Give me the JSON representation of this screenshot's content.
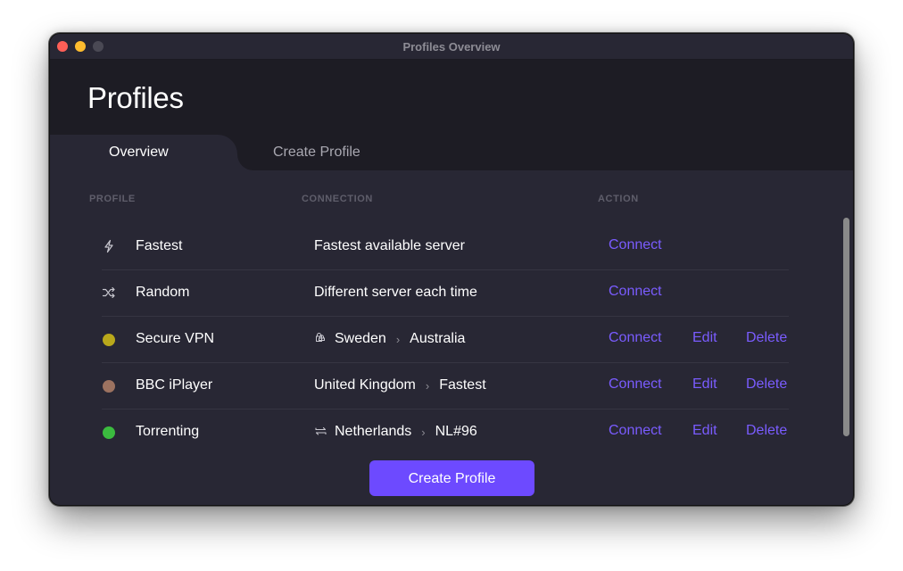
{
  "window": {
    "title": "Profiles Overview",
    "controls": [
      "close",
      "minimize",
      "maximize"
    ]
  },
  "header": {
    "title": "Profiles"
  },
  "tabs": [
    {
      "label": "Overview",
      "active": true
    },
    {
      "label": "Create Profile",
      "active": false
    }
  ],
  "table": {
    "columns": [
      "PROFILE",
      "CONNECTION",
      "ACTION"
    ],
    "rows": [
      {
        "icon": "lightning-icon",
        "name": "Fastest",
        "connection": {
          "text": "Fastest available server"
        },
        "actions": [
          "Connect"
        ]
      },
      {
        "icon": "shuffle-icon",
        "name": "Random",
        "connection": {
          "text": "Different server each time"
        },
        "actions": [
          "Connect"
        ]
      },
      {
        "dot_color": "#b9a81b",
        "name": "Secure VPN",
        "connection": {
          "icon": "secure-core-lock-icon",
          "from": "Sweden",
          "to": "Australia"
        },
        "actions": [
          "Connect",
          "Edit",
          "Delete"
        ]
      },
      {
        "dot_color": "#9c7260",
        "name": "BBC iPlayer",
        "connection": {
          "from": "United Kingdom",
          "to": "Fastest"
        },
        "actions": [
          "Connect",
          "Edit",
          "Delete"
        ]
      },
      {
        "dot_color": "#3bbb3f",
        "name": "Torrenting",
        "connection": {
          "icon": "p2p-arrows-icon",
          "from": "Netherlands",
          "to": "NL#96"
        },
        "actions": [
          "Connect",
          "Edit",
          "Delete"
        ]
      }
    ]
  },
  "footer": {
    "create_button_label": "Create Profile"
  },
  "colors": {
    "accent": "#6d4aff",
    "link": "#7a5cff",
    "background": "#282734",
    "header_background": "#1d1c24"
  }
}
